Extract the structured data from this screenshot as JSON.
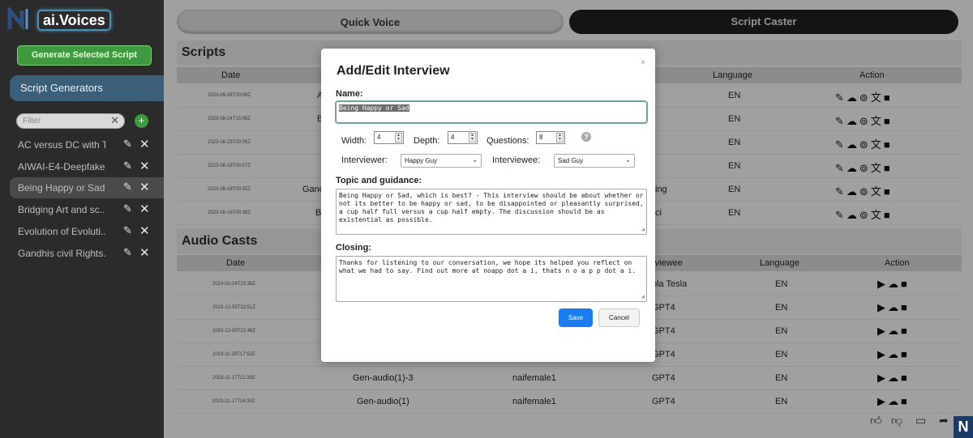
{
  "app": {
    "logo_letter": "N",
    "title": "ai.Voices"
  },
  "sidebar": {
    "generate_label": "Generate Selected Script",
    "section_label": "Script Generators",
    "filter_placeholder": "Filter",
    "items": [
      {
        "label": "AC versus DC with T..."
      },
      {
        "label": "AIWAI-E4-Deepfakes"
      },
      {
        "label": "Being Happy or Sad"
      },
      {
        "label": "Bridging Art and sc..."
      },
      {
        "label": "Evolution of Evoluti..."
      },
      {
        "label": "Gandhis civil Rights..."
      }
    ]
  },
  "tabs": {
    "quick": "Quick Voice",
    "caster": "Script Caster"
  },
  "scripts": {
    "title": "Scripts",
    "headers": {
      "date": "Date",
      "language": "Language",
      "action": "Action"
    },
    "rows": [
      {
        "date": "2023-09-28T20:09Z",
        "title_frag": "A",
        "right_frag": "",
        "lang": "EN"
      },
      {
        "date": "2023-08-24T15:06Z",
        "title_frag": "B",
        "right_frag": "",
        "lang": "EN"
      },
      {
        "date": "2023-08-23T00:09Z",
        "title_frag": "",
        "right_frag": "",
        "lang": "EN"
      },
      {
        "date": "2023-08-18T00:57Z",
        "title_frag": "",
        "right_frag": "",
        "lang": "EN"
      },
      {
        "date": "2023-08-18T00:55Z",
        "title_frag": "Ganc",
        "right_frag": "ing",
        "lang": "EN"
      },
      {
        "date": "2023-08-16T00:36Z",
        "title_frag": "B",
        "right_frag": "ci",
        "lang": "EN"
      }
    ]
  },
  "audio": {
    "title": "Audio Casts",
    "headers": {
      "date": "Date",
      "interviewee": "rviewee",
      "language": "Language",
      "action": "Action"
    },
    "rows": [
      {
        "date": "2024-01-04T23:36Z",
        "name": "",
        "voice": "",
        "interviewee": "ola Tesla",
        "lang": "EN"
      },
      {
        "date": "2023-12-05T22:51Z",
        "name": "",
        "voice": "",
        "interviewee": "GPT4",
        "lang": "EN"
      },
      {
        "date": "2023-12-05T22:46Z",
        "name": "",
        "voice": "",
        "interviewee": "GPT4",
        "lang": "EN"
      },
      {
        "date": "2023-11-29T17:52Z",
        "name": "",
        "voice": "",
        "interviewee": "GPT4",
        "lang": "EN"
      },
      {
        "date": "2023-11-17T21:39Z",
        "name": "Gen-audio(1)-3",
        "voice": "naifemale1",
        "interviewee": "GPT4",
        "lang": "EN"
      },
      {
        "date": "2023-11-17T16:30Z",
        "name": "Gen-audio(1)",
        "voice": "naifemale1",
        "interviewee": "GPT4",
        "lang": "EN"
      }
    ]
  },
  "modal": {
    "title": "Add/Edit Interview",
    "close": "×",
    "name_label": "Name:",
    "name_value": "Being Happy or Sad",
    "width_label": "Width:",
    "width_value": "4",
    "depth_label": "Depth:",
    "depth_value": "4",
    "questions_label": "Questions:",
    "questions_value": "8",
    "help": "?",
    "interviewer_label": "Interviewer:",
    "interviewer_value": "Happy Guy",
    "interviewee_label": "Interviewee:",
    "interviewee_value": "Sad Guy",
    "topic_label": "Topic and guidance:",
    "topic_value": "Being Happy or Sad, which is best? - This interview should be about whether or not its better to be happy or sad, to be disappointed or pleasantly surprised, a cup half full versus a cup half empty. The discussion should be as existential as possible.",
    "closing_label": "Closing:",
    "closing_value": "Thanks for listening to our conversation, we hope its helped you reflect on what we had to say. Find out more at noapp dot a i, thats n o a p p dot a i.",
    "save": "Save",
    "cancel": "Cancel"
  },
  "corner_logo": "N",
  "colors": {
    "accent_green": "#3f9a3f",
    "save_blue": "#1a7cf0",
    "sidebar_bg": "#2b2b2b",
    "section_blue": "#3b5f78"
  }
}
